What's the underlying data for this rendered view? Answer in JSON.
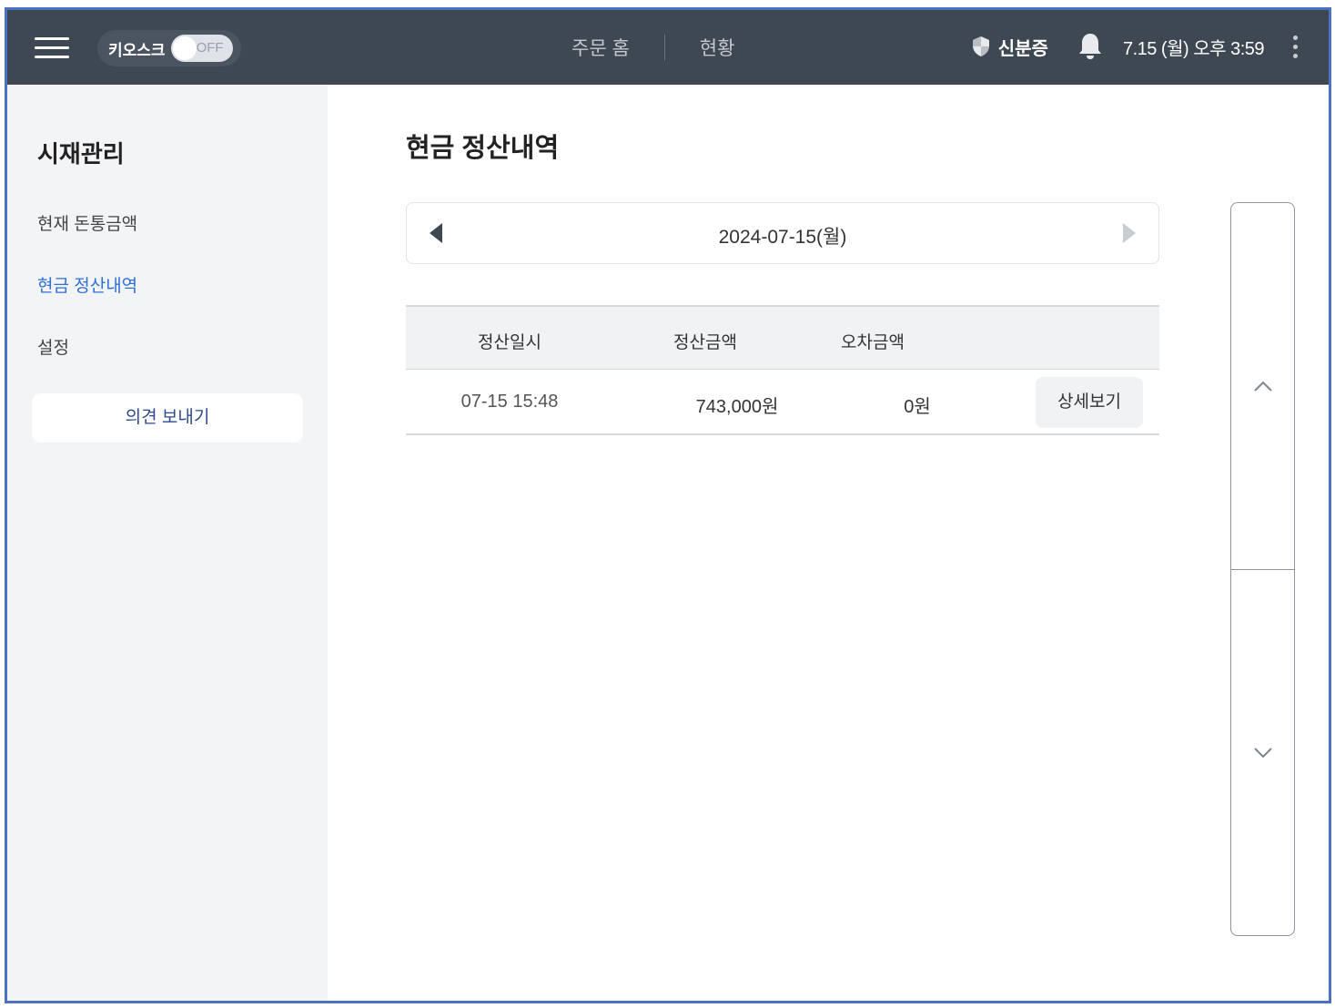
{
  "header": {
    "kiosk_label": "키오스크",
    "kiosk_toggle": "OFF",
    "nav": [
      "주문 홈",
      "현황"
    ],
    "id_label": "신분증",
    "datetime": "7.15 (월) 오후 3:59"
  },
  "sidebar": {
    "title": "시재관리",
    "items": [
      "현재 돈통금액",
      "현금 정산내역",
      "설정"
    ],
    "active_index": 1,
    "feedback": "의견 보내기"
  },
  "main": {
    "title": "현금 정산내역",
    "date": "2024-07-15(월)",
    "columns": [
      "정산일시",
      "정산금액",
      "오차금액"
    ],
    "rows": [
      {
        "datetime": "07-15 15:48",
        "amount": "743,000원",
        "diff": "0원",
        "action": "상세보기"
      }
    ]
  },
  "colors": {
    "accent": "#2f6fd6",
    "header": "#3e4853"
  }
}
